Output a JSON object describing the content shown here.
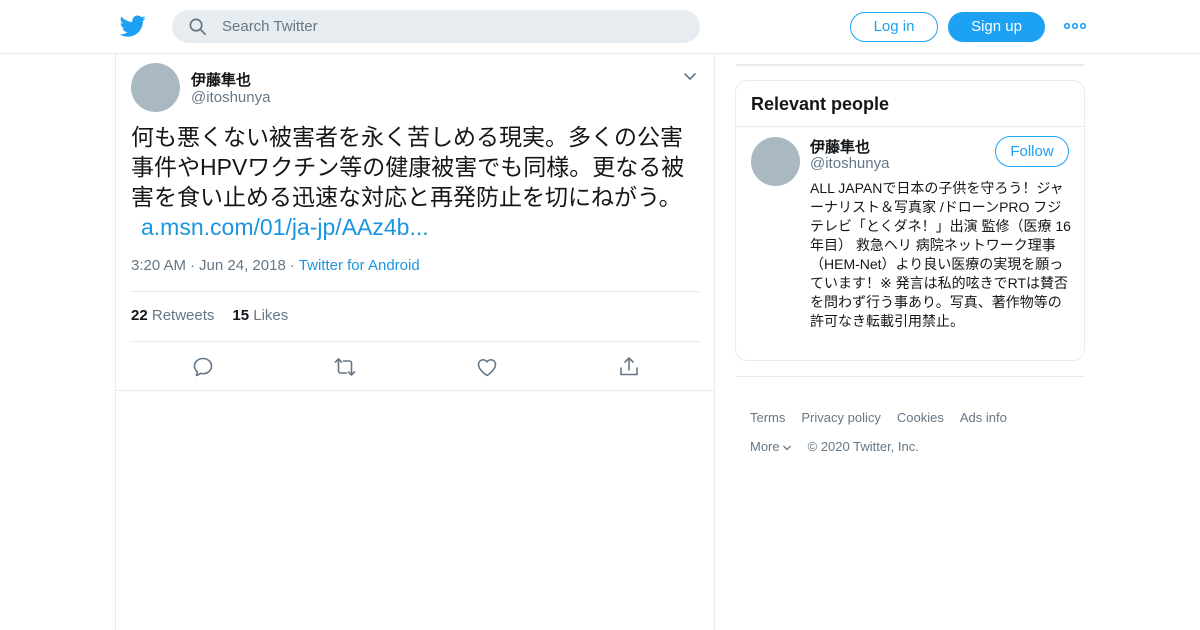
{
  "header": {
    "search_placeholder": "Search Twitter",
    "login_label": "Log in",
    "signup_label": "Sign up"
  },
  "tweet": {
    "name": "伊藤隼也",
    "handle": "@itoshunya",
    "text": "何も悪くない被害者を永く苦しめる現実。多くの公害事件やHPVワクチン等の健康被害でも同様。更なる被害を食い止める迅速な対応と再発防止を切にねがう。",
    "link": "a.msn.com/01/ja-jp/AAz4b...",
    "time": "3:20 AM",
    "date": "Jun 24, 2018",
    "source": "Twitter for Android",
    "retweets_count": "22",
    "retweets_label": "Retweets",
    "likes_count": "15",
    "likes_label": "Likes"
  },
  "sidebar": {
    "relevant_title": "Relevant people",
    "person": {
      "name": "伊藤隼也",
      "handle": "@itoshunya",
      "follow_label": "Follow",
      "bio": "ALL JAPANで日本の子供を守ろう！ジャーナリスト＆写真家 /ドローンPRO フジテレビ「とくダネ！」出演 監修（医療 16年目） 救急ヘリ 病院ネットワーク理事（HEM-Net）より良い医療の実現を願っています！※ 発言は私的呟きでRTは賛否を問わず行う事あり。写真、著作物等の許可なき転載引用禁止。"
    }
  },
  "footer": {
    "terms": "Terms",
    "privacy": "Privacy policy",
    "cookies": "Cookies",
    "ads_info": "Ads info",
    "more": "More",
    "copyright": "© 2020 Twitter, Inc."
  },
  "colors": {
    "brand": "#1da1f2",
    "link": "#1b95e0",
    "muted": "#657786",
    "border": "#e6ecf0",
    "avatar_placeholder": "#aab8c2"
  },
  "icons": [
    "twitter-bird-icon",
    "search-icon",
    "more-dots-icon",
    "chevron-down-icon",
    "reply-icon",
    "retweet-icon",
    "like-icon",
    "share-icon"
  ]
}
